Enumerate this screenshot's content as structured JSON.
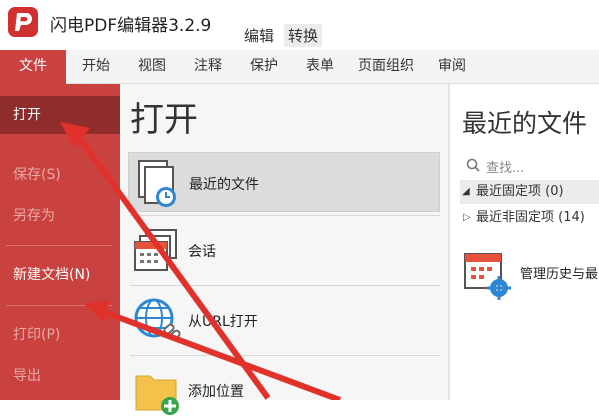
{
  "app": {
    "title": "闪电PDF编辑器3.2.9",
    "context_tabs": [
      "编辑",
      "转换"
    ]
  },
  "ribbon": {
    "tabs": [
      "文件",
      "开始",
      "视图",
      "注释",
      "保护",
      "表单",
      "页面组织",
      "审阅"
    ]
  },
  "file_menu": {
    "items": [
      "打开",
      "保存(S)",
      "另存为",
      "新建文档(N)",
      "打印(P)",
      "导出"
    ]
  },
  "open_panel": {
    "title": "打开",
    "places": [
      "最近的文件",
      "会话",
      "从URL打开",
      "添加位置"
    ]
  },
  "recent_panel": {
    "title": "最近的文件",
    "search_placeholder": "查找...",
    "groups": [
      "最近固定项 (0)",
      "最近非固定项 (14)"
    ],
    "manage_label": "管理历史与最"
  },
  "colors": {
    "accent": "#c9423f",
    "active": "#8e2d2b",
    "arrow": "#e0312b"
  }
}
